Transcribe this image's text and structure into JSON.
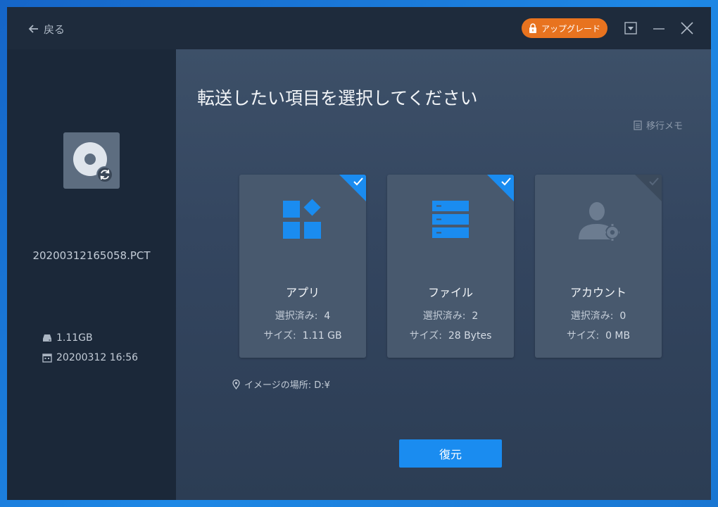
{
  "titlebar": {
    "back_label": "戻る",
    "upgrade_label": "アップグレード"
  },
  "sidebar": {
    "filename": "20200312165058.PCT",
    "size": "1.11GB",
    "date": "20200312 16:56"
  },
  "main": {
    "title": "転送したい項目を選択してください",
    "memo_label": "移行メモ",
    "location_label": "イメージの場所: D:¥",
    "restore_label": "復元"
  },
  "cards": [
    {
      "title": "アプリ",
      "selected_key": "選択済み:",
      "selected_value": "4",
      "size_key": "サイズ:",
      "size_value": "1.11 GB",
      "checked": true
    },
    {
      "title": "ファイル",
      "selected_key": "選択済み:",
      "selected_value": "2",
      "size_key": "サイズ:",
      "size_value": "28 Bytes",
      "checked": true
    },
    {
      "title": "アカウント",
      "selected_key": "選択済み:",
      "selected_value": "0",
      "size_key": "サイズ:",
      "size_value": "0 MB",
      "checked": false
    }
  ],
  "colors": {
    "accent": "#1a8cf0",
    "upgrade": "#e8731f",
    "card_bg": "#48596e",
    "sidebar_bg": "#1b2839"
  },
  "icons": [
    "back-arrow-icon",
    "lock-icon",
    "minimize-to-tray-icon",
    "minimize-icon",
    "close-icon",
    "disk-image-icon",
    "sync-icon",
    "drive-icon",
    "calendar-icon",
    "memo-icon",
    "apps-icon",
    "files-icon",
    "account-icon",
    "checkmark-icon",
    "location-pin-icon"
  ]
}
